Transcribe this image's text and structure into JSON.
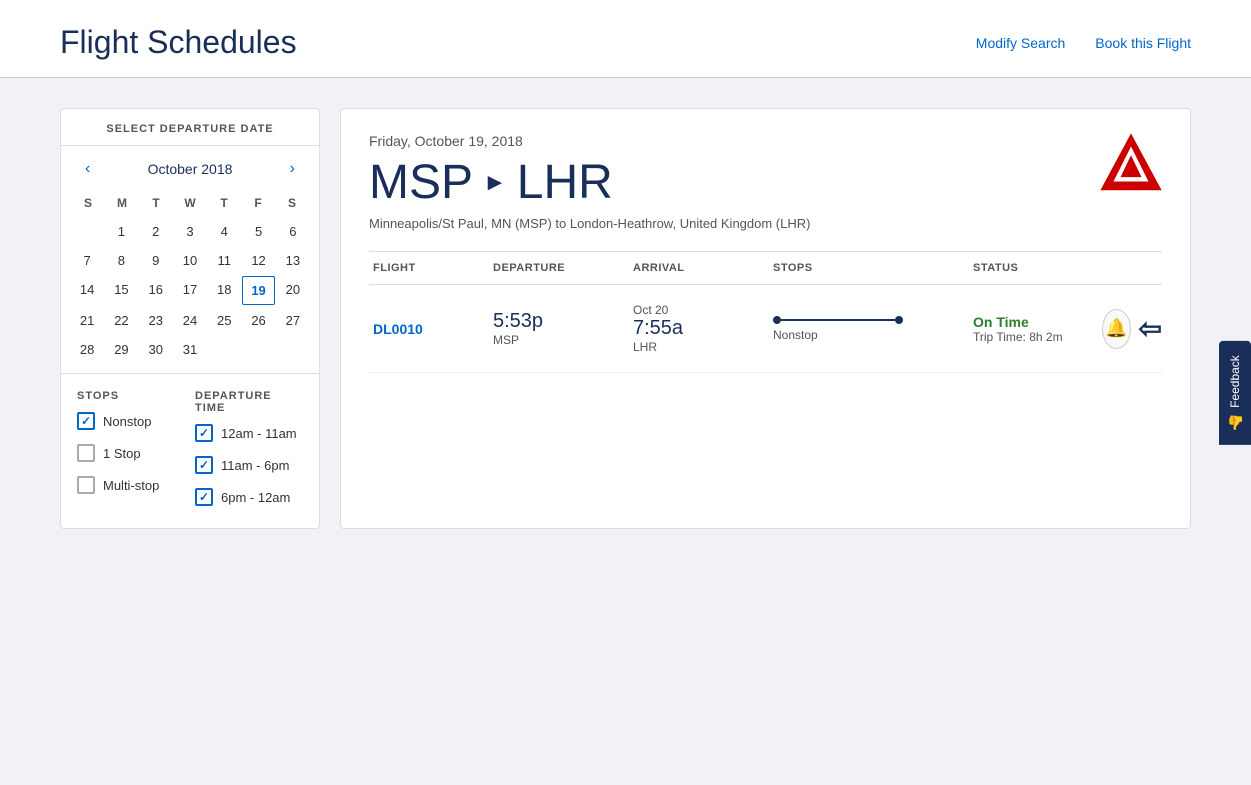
{
  "header": {
    "title": "Flight Schedules",
    "modify_search": "Modify Search",
    "book_flight": "Book this Flight"
  },
  "sidebar": {
    "section_title": "SELECT DEPARTURE DATE",
    "calendar": {
      "month_year": "October 2018",
      "days_header": [
        "S",
        "M",
        "T",
        "W",
        "T",
        "F",
        "S"
      ],
      "weeks": [
        [
          "",
          "1",
          "2",
          "3",
          "4",
          "5",
          "6"
        ],
        [
          "7",
          "8",
          "9",
          "10",
          "11",
          "12",
          "13"
        ],
        [
          "14",
          "15",
          "16",
          "17",
          "18",
          "19",
          "20"
        ],
        [
          "21",
          "22",
          "23",
          "24",
          "25",
          "26",
          "27"
        ],
        [
          "28",
          "29",
          "30",
          "31",
          "",
          "",
          ""
        ]
      ],
      "today": "19"
    },
    "filters": {
      "stops_label": "STOPS",
      "departure_label": "DEPARTURE TIME",
      "stop_options": [
        {
          "label": "Nonstop",
          "checked": true
        },
        {
          "label": "1 Stop",
          "checked": false
        },
        {
          "label": "Multi-stop",
          "checked": false
        }
      ],
      "time_options": [
        {
          "label": "12am - 11am",
          "checked": true
        },
        {
          "label": "11am - 6pm",
          "checked": true
        },
        {
          "label": "6pm - 12am",
          "checked": true
        }
      ]
    }
  },
  "results": {
    "date": "Friday, October 19, 2018",
    "origin_code": "MSP",
    "destination_code": "LHR",
    "route_separator": "▸",
    "route_full": "Minneapolis/St Paul, MN (MSP) to London-Heathrow, United Kingdom (LHR)",
    "table_headers": {
      "flight": "FLIGHT",
      "departure": "DEPARTURE",
      "arrival": "ARRIVAL",
      "stops": "STOPS",
      "status": "STATUS"
    },
    "flights": [
      {
        "number": "DL0010",
        "departure_time": "5:53p",
        "departure_airport": "MSP",
        "arrival_date": "Oct 20",
        "arrival_time": "7:55a",
        "arrival_airport": "LHR",
        "stops": "Nonstop",
        "status": "On Time",
        "trip_time": "Trip Time: 8h 2m"
      }
    ]
  },
  "feedback": {
    "label": "Feedback"
  }
}
